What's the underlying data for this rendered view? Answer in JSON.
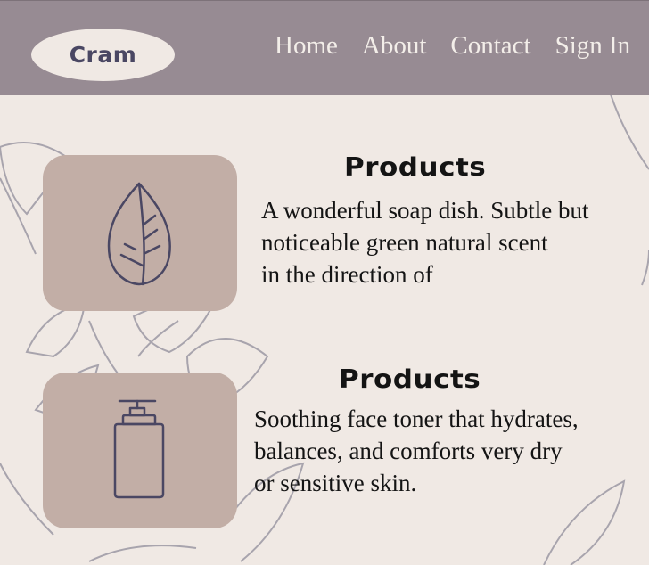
{
  "brand": {
    "logo_text": "Cram"
  },
  "nav": {
    "home": "Home",
    "about": "About",
    "contact": "Contact",
    "sign_in": "Sign In"
  },
  "products": [
    {
      "icon": "leaf-icon",
      "heading": "Products",
      "line1": "A wonderful soap dish.  Subtle but",
      "line2": "noticeable green natural scent",
      "line3": "in the direction of"
    },
    {
      "icon": "pump-bottle-icon",
      "heading": "Products",
      "line1": "Soothing face toner that hydrates,",
      "line2": "balances, and comforts very dry",
      "line3": "or sensitive skin."
    }
  ],
  "colors": {
    "page_bg": "#f0e9e4",
    "header_bg": "#978b93",
    "card_bg": "#c2aea6",
    "icon_stroke": "#4a4763",
    "leaf_outline": "#a8a4ad"
  }
}
